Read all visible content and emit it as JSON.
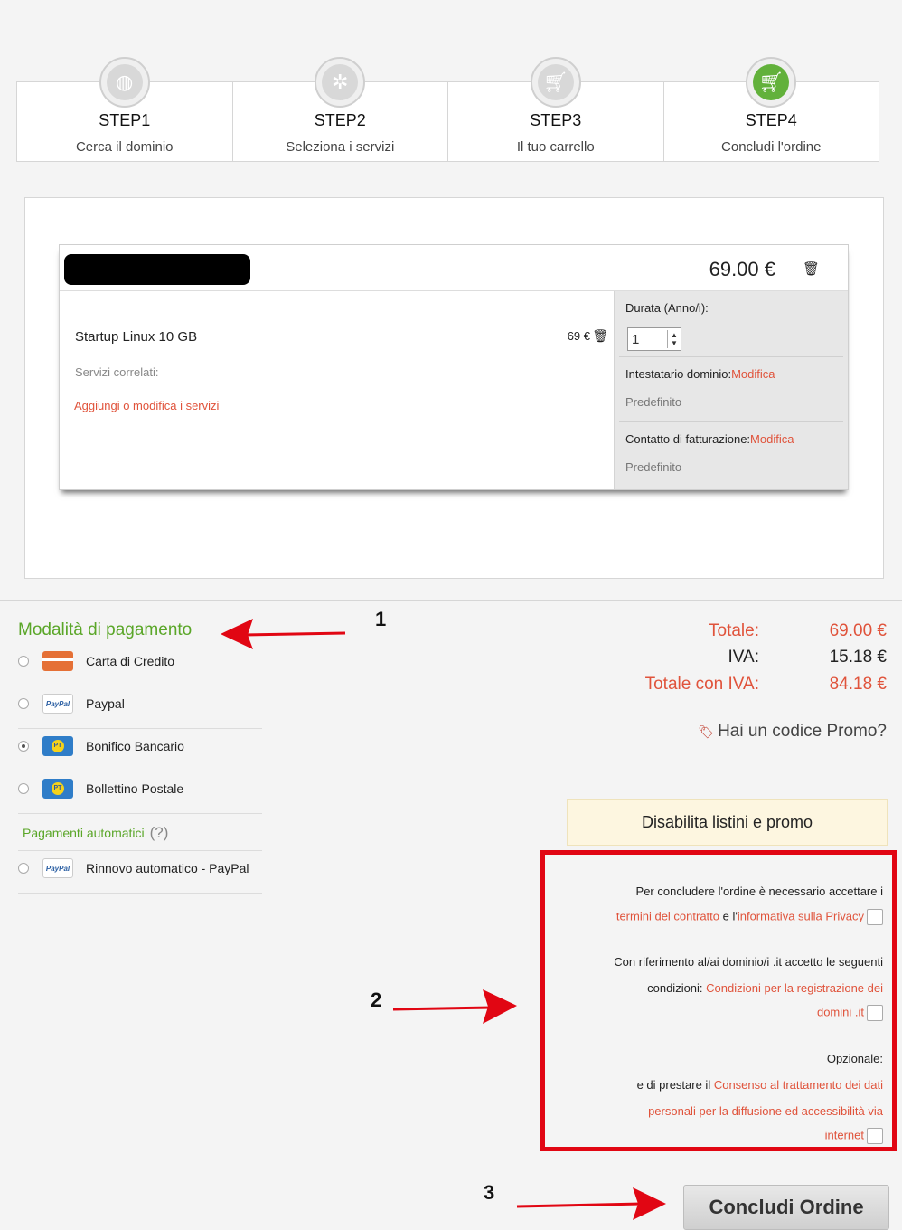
{
  "steps": [
    {
      "title": "STEP1",
      "subtitle": "Cerca il dominio",
      "icon": "globe-icon"
    },
    {
      "title": "STEP2",
      "subtitle": "Seleziona i servizi",
      "icon": "network-icon"
    },
    {
      "title": "STEP3",
      "subtitle": "Il tuo carrello",
      "icon": "cart-icon"
    },
    {
      "title": "STEP4",
      "subtitle": "Concludi l'ordine",
      "icon": "cart-icon",
      "active": true
    }
  ],
  "cart": {
    "domain_price": "69.00 €",
    "product_name": "Startup Linux 10 GB",
    "product_price": "69 €",
    "related_label": "Servizi correlati:",
    "add_services_link": "Aggiungi o modifica i servizi",
    "duration_label": "Durata (Anno/i):",
    "duration_value": "1",
    "registrant_label": "Intestatario dominio:",
    "registrant_link": "Modifica",
    "registrant_value": "Predefinito",
    "billing_label": "Contatto di fatturazione:",
    "billing_link": "Modifica",
    "billing_value": "Predefinito"
  },
  "payment": {
    "title": "Modalità di pagamento",
    "methods": [
      {
        "label": "Carta di Credito",
        "icon": "credit-card-icon",
        "checked": false
      },
      {
        "label": "Paypal",
        "icon": "paypal-icon",
        "checked": false
      },
      {
        "label": "Bonifico Bancario",
        "icon": "poste-icon",
        "checked": true
      },
      {
        "label": "Bollettino Postale",
        "icon": "poste-icon",
        "checked": false
      }
    ],
    "auto_title": "Pagamenti automatici",
    "auto_help": "(?)",
    "auto_methods": [
      {
        "label": "Rinnovo automatico - PayPal",
        "icon": "paypal-icon",
        "checked": false
      }
    ]
  },
  "totals": {
    "total_label": "Totale:",
    "total_value": "69.00 €",
    "vat_label": "IVA:",
    "vat_value": "15.18 €",
    "total_vat_label": "Totale con IVA:",
    "total_vat_value": "84.18 €",
    "promo_label": "Hai un codice Promo?"
  },
  "disable_button": "Disabilita listini e promo",
  "terms": {
    "l1": "Per concludere l'ordine è necessario accettare i",
    "l2_link1": "termini del contratto",
    "l2_and": " e l'",
    "l2_link2": "informativa sulla Privacy",
    "l3": "Con riferimento al/ai dominio/i .it accetto le seguenti",
    "l4_text": "condizioni: ",
    "l4_link": "Condizioni per la registrazione dei",
    "l5_link": "domini .it",
    "l6": "Opzionale:",
    "l7_text": "e di prestare il ",
    "l7_link": "Consenso al trattamento dei dati",
    "l8_link": "personali per la diffusione ed accessibilità via",
    "l9_link": "internet"
  },
  "submit_button": "Concludi Ordine",
  "annotations": [
    "1",
    "2",
    "3"
  ],
  "colors": {
    "accent_green": "#5aa628",
    "link_red": "#e0533b",
    "frame_red": "#e10613"
  }
}
